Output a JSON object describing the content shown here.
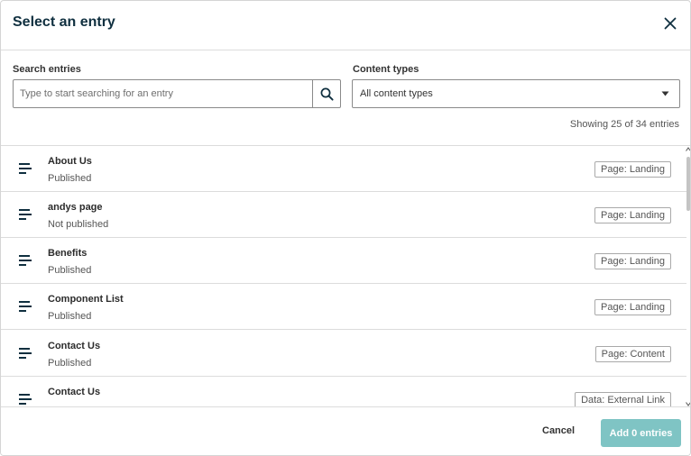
{
  "dialog": {
    "title": "Select an entry"
  },
  "search": {
    "label": "Search entries",
    "placeholder": "Type to start searching for an entry",
    "value": ""
  },
  "content_types": {
    "label": "Content types",
    "selected": "All content types"
  },
  "results": {
    "count_text": "Showing 25 of 34 entries"
  },
  "entries": [
    {
      "name": "About Us",
      "status": "Published",
      "tag": "Page: Landing"
    },
    {
      "name": "andys page",
      "status": "Not published",
      "tag": "Page: Landing"
    },
    {
      "name": "Benefits",
      "status": "Published",
      "tag": "Page: Landing"
    },
    {
      "name": "Component List",
      "status": "Published",
      "tag": "Page: Landing"
    },
    {
      "name": "Contact Us",
      "status": "Published",
      "tag": "Page: Content"
    },
    {
      "name": "Contact Us",
      "status": "",
      "tag": "Data: External Link"
    }
  ],
  "footer": {
    "cancel_label": "Cancel",
    "add_label": "Add 0 entries"
  },
  "colors": {
    "title": "#0f2f3f",
    "primary_button_disabled": "#7fc4c4",
    "icon": "#0f2f3f"
  },
  "icons": {
    "close": "close-icon",
    "search": "search-icon",
    "dropdown": "chevron-down-icon",
    "entry": "entry-lines-icon"
  }
}
